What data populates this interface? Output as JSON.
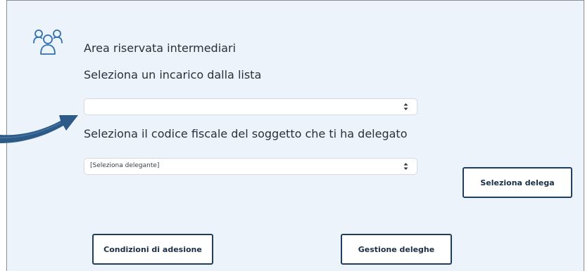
{
  "area_title": "Area riservata intermediari",
  "incarico": {
    "label": "Seleziona un incarico dalla lista",
    "selected": ""
  },
  "delegante": {
    "label": "Seleziona il codice fiscale del soggetto che ti ha delegato",
    "selected": "[Seleziona delegante]"
  },
  "buttons": {
    "seleziona_delega": "Seleziona delega",
    "condizioni": "Condizioni di adesione",
    "gestione": "Gestione deleghe"
  },
  "icons": {
    "area": "users-icon",
    "select_arrows": "sort-arrows-icon",
    "pointer": "curved-arrow-icon"
  },
  "colors": {
    "panel_bg": "#edf3fb",
    "icon": "#2f6fb4",
    "button_border": "#1e3f62",
    "arrow": "#2d5a86"
  }
}
